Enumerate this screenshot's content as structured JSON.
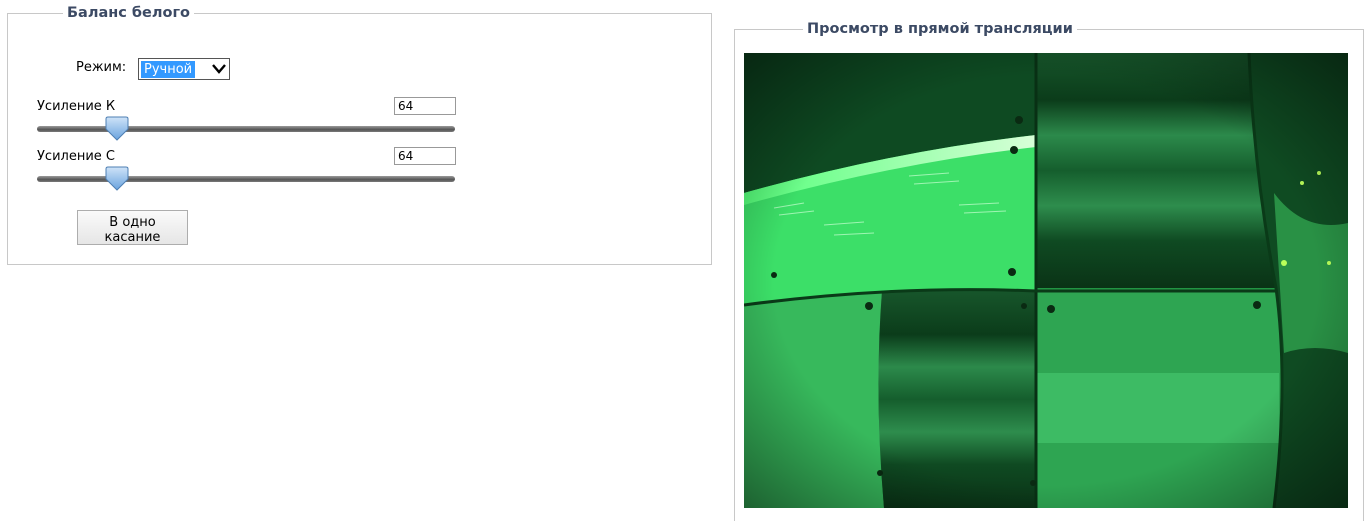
{
  "white_balance": {
    "title": "Баланс белого",
    "mode_label": "Режим:",
    "mode_value": "Ручной",
    "gain_r": {
      "label": "Усиление К",
      "value": "64",
      "level": 0.15
    },
    "gain_b": {
      "label": "Усиление С",
      "value": "64",
      "level": 0.15
    },
    "one_push_label": "В одно касание"
  },
  "live_view": {
    "title": "Просмотр в прямой трансляции"
  },
  "colors": {
    "legend_text": "#3c4a64",
    "select_highlight": "#3399ff",
    "slider_thumb": "#7fb2e8",
    "video_tint": "#19c94a"
  },
  "icons": {
    "mode_dropdown": "chevron-down-icon",
    "slider_thumb": "slider-thumb-icon"
  }
}
